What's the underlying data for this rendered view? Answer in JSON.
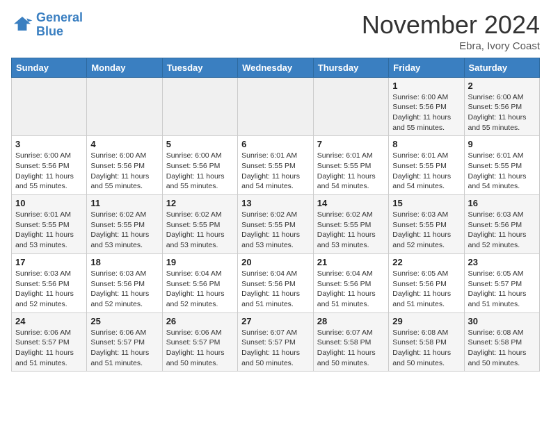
{
  "header": {
    "logo_line1": "General",
    "logo_line2": "Blue",
    "month": "November 2024",
    "location": "Ebra, Ivory Coast"
  },
  "weekdays": [
    "Sunday",
    "Monday",
    "Tuesday",
    "Wednesday",
    "Thursday",
    "Friday",
    "Saturday"
  ],
  "weeks": [
    [
      {
        "day": "",
        "info": ""
      },
      {
        "day": "",
        "info": ""
      },
      {
        "day": "",
        "info": ""
      },
      {
        "day": "",
        "info": ""
      },
      {
        "day": "",
        "info": ""
      },
      {
        "day": "1",
        "info": "Sunrise: 6:00 AM\nSunset: 5:56 PM\nDaylight: 11 hours\nand 55 minutes."
      },
      {
        "day": "2",
        "info": "Sunrise: 6:00 AM\nSunset: 5:56 PM\nDaylight: 11 hours\nand 55 minutes."
      }
    ],
    [
      {
        "day": "3",
        "info": "Sunrise: 6:00 AM\nSunset: 5:56 PM\nDaylight: 11 hours\nand 55 minutes."
      },
      {
        "day": "4",
        "info": "Sunrise: 6:00 AM\nSunset: 5:56 PM\nDaylight: 11 hours\nand 55 minutes."
      },
      {
        "day": "5",
        "info": "Sunrise: 6:00 AM\nSunset: 5:56 PM\nDaylight: 11 hours\nand 55 minutes."
      },
      {
        "day": "6",
        "info": "Sunrise: 6:01 AM\nSunset: 5:55 PM\nDaylight: 11 hours\nand 54 minutes."
      },
      {
        "day": "7",
        "info": "Sunrise: 6:01 AM\nSunset: 5:55 PM\nDaylight: 11 hours\nand 54 minutes."
      },
      {
        "day": "8",
        "info": "Sunrise: 6:01 AM\nSunset: 5:55 PM\nDaylight: 11 hours\nand 54 minutes."
      },
      {
        "day": "9",
        "info": "Sunrise: 6:01 AM\nSunset: 5:55 PM\nDaylight: 11 hours\nand 54 minutes."
      }
    ],
    [
      {
        "day": "10",
        "info": "Sunrise: 6:01 AM\nSunset: 5:55 PM\nDaylight: 11 hours\nand 53 minutes."
      },
      {
        "day": "11",
        "info": "Sunrise: 6:02 AM\nSunset: 5:55 PM\nDaylight: 11 hours\nand 53 minutes."
      },
      {
        "day": "12",
        "info": "Sunrise: 6:02 AM\nSunset: 5:55 PM\nDaylight: 11 hours\nand 53 minutes."
      },
      {
        "day": "13",
        "info": "Sunrise: 6:02 AM\nSunset: 5:55 PM\nDaylight: 11 hours\nand 53 minutes."
      },
      {
        "day": "14",
        "info": "Sunrise: 6:02 AM\nSunset: 5:55 PM\nDaylight: 11 hours\nand 53 minutes."
      },
      {
        "day": "15",
        "info": "Sunrise: 6:03 AM\nSunset: 5:55 PM\nDaylight: 11 hours\nand 52 minutes."
      },
      {
        "day": "16",
        "info": "Sunrise: 6:03 AM\nSunset: 5:56 PM\nDaylight: 11 hours\nand 52 minutes."
      }
    ],
    [
      {
        "day": "17",
        "info": "Sunrise: 6:03 AM\nSunset: 5:56 PM\nDaylight: 11 hours\nand 52 minutes."
      },
      {
        "day": "18",
        "info": "Sunrise: 6:03 AM\nSunset: 5:56 PM\nDaylight: 11 hours\nand 52 minutes."
      },
      {
        "day": "19",
        "info": "Sunrise: 6:04 AM\nSunset: 5:56 PM\nDaylight: 11 hours\nand 52 minutes."
      },
      {
        "day": "20",
        "info": "Sunrise: 6:04 AM\nSunset: 5:56 PM\nDaylight: 11 hours\nand 51 minutes."
      },
      {
        "day": "21",
        "info": "Sunrise: 6:04 AM\nSunset: 5:56 PM\nDaylight: 11 hours\nand 51 minutes."
      },
      {
        "day": "22",
        "info": "Sunrise: 6:05 AM\nSunset: 5:56 PM\nDaylight: 11 hours\nand 51 minutes."
      },
      {
        "day": "23",
        "info": "Sunrise: 6:05 AM\nSunset: 5:57 PM\nDaylight: 11 hours\nand 51 minutes."
      }
    ],
    [
      {
        "day": "24",
        "info": "Sunrise: 6:06 AM\nSunset: 5:57 PM\nDaylight: 11 hours\nand 51 minutes."
      },
      {
        "day": "25",
        "info": "Sunrise: 6:06 AM\nSunset: 5:57 PM\nDaylight: 11 hours\nand 51 minutes."
      },
      {
        "day": "26",
        "info": "Sunrise: 6:06 AM\nSunset: 5:57 PM\nDaylight: 11 hours\nand 50 minutes."
      },
      {
        "day": "27",
        "info": "Sunrise: 6:07 AM\nSunset: 5:57 PM\nDaylight: 11 hours\nand 50 minutes."
      },
      {
        "day": "28",
        "info": "Sunrise: 6:07 AM\nSunset: 5:58 PM\nDaylight: 11 hours\nand 50 minutes."
      },
      {
        "day": "29",
        "info": "Sunrise: 6:08 AM\nSunset: 5:58 PM\nDaylight: 11 hours\nand 50 minutes."
      },
      {
        "day": "30",
        "info": "Sunrise: 6:08 AM\nSunset: 5:58 PM\nDaylight: 11 hours\nand 50 minutes."
      }
    ]
  ]
}
